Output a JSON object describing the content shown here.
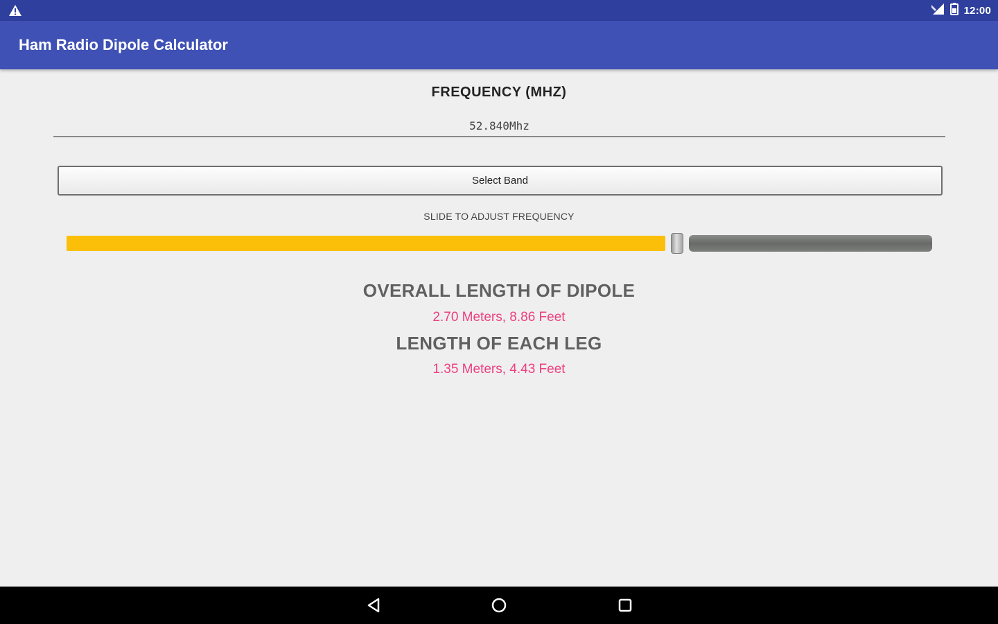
{
  "status_bar": {
    "time": "12:00",
    "icons": [
      "warning-icon",
      "signal-icon",
      "battery-icon"
    ],
    "background": "#2f3f9e"
  },
  "app_bar": {
    "title": "Ham Radio Dipole Calculator",
    "background": "#3f51b5"
  },
  "frequency": {
    "heading": "FREQUENCY (MHZ)",
    "value": "52.840Mhz"
  },
  "band_button": {
    "label": "Select Band"
  },
  "slider": {
    "label": "SLIDE TO ADJUST FREQUENCY",
    "position": 0.708,
    "fill_color": "#fbbf0a"
  },
  "results": {
    "overall": {
      "heading": "OVERALL LENGTH OF DIPOLE",
      "value": "2.70 Meters, 8.86 Feet"
    },
    "leg": {
      "heading": "LENGTH OF EACH LEG",
      "value": "1.35 Meters, 4.43 Feet"
    },
    "value_color": "#ee3f7f"
  },
  "nav_bar": {
    "icons": [
      "back-icon",
      "home-icon",
      "recents-icon"
    ]
  }
}
